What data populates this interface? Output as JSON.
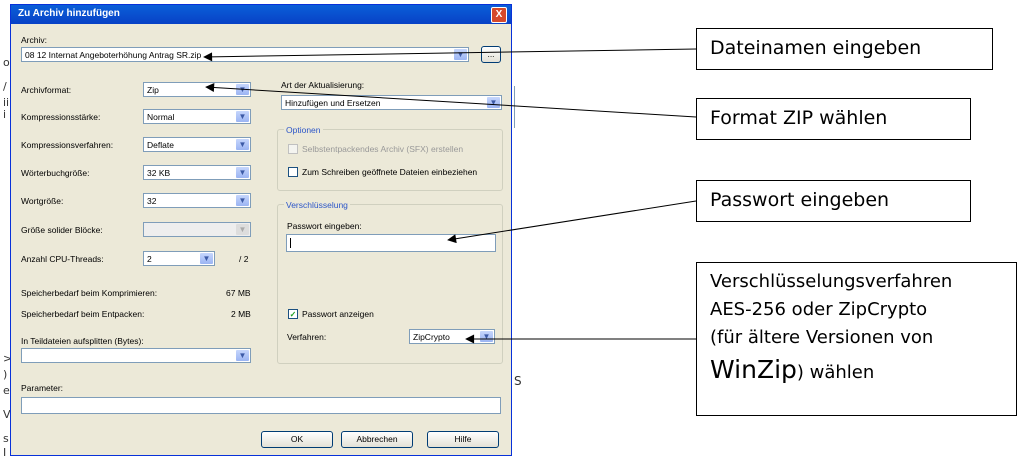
{
  "dialog": {
    "title": "Zu Archiv hinzufügen",
    "close": "X",
    "archive_label": "Archiv:",
    "archive_value": "08 12 Internat Angeboterhöhung Antrag SR.zip",
    "browse_label": "...",
    "format_label": "Archivformat:",
    "format_value": "Zip",
    "compression_level_label": "Kompressionsstärke:",
    "compression_level_value": "Normal",
    "compression_method_label": "Kompressionsverfahren:",
    "compression_method_value": "Deflate",
    "dictionary_label": "Wörterbuchgröße:",
    "dictionary_value": "32 KB",
    "word_label": "Wortgröße:",
    "word_value": "32",
    "solid_label": "Größe solider Blöcke:",
    "threads_label": "Anzahl CPU-Threads:",
    "threads_value": "2",
    "threads_total": "/ 2",
    "mem_compress_label": "Speicherbedarf beim Komprimieren:",
    "mem_compress_value": "67 MB",
    "mem_decompress_label": "Speicherbedarf beim Entpacken:",
    "mem_decompress_value": "2 MB",
    "split_label": "In Teildateien aufsplitten (Bytes):",
    "params_label": "Parameter:",
    "update_label": "Art der Aktualisierung:",
    "update_value": "Hinzufügen und Ersetzen",
    "options_title": "Optionen",
    "sfx_label": "Selbstentpackendes Archiv (SFX) erstellen",
    "shared_label": "Zum Schreiben geöffnete Dateien einbeziehen",
    "encryption_title": "Verschlüsselung",
    "password_label": "Passwort eingeben:",
    "show_password_label": "Passwort anzeigen",
    "method_label": "Verfahren:",
    "method_value": "ZipCrypto",
    "ok_label": "OK",
    "cancel_label": "Abbrechen",
    "help_label": "Hilfe"
  },
  "callouts": {
    "filename": "Dateinamen eingeben",
    "format": "Format ZIP wählen",
    "password": "Passwort eingeben",
    "enc_line1": "Verschlüsselungsverfahren",
    "enc_line2": "AES-256 oder ZipCrypto",
    "enc_line3": "(für ältere Versionen von",
    "enc_line4a": "WinZip",
    "enc_line4b": ") wählen"
  },
  "edge_chars": [
    "o",
    "/",
    "ii",
    "i",
    ":",
    "",
    "",
    "",
    "",
    ">",
    ")",
    "e",
    "V",
    "s",
    "I"
  ],
  "edge_right": "S"
}
